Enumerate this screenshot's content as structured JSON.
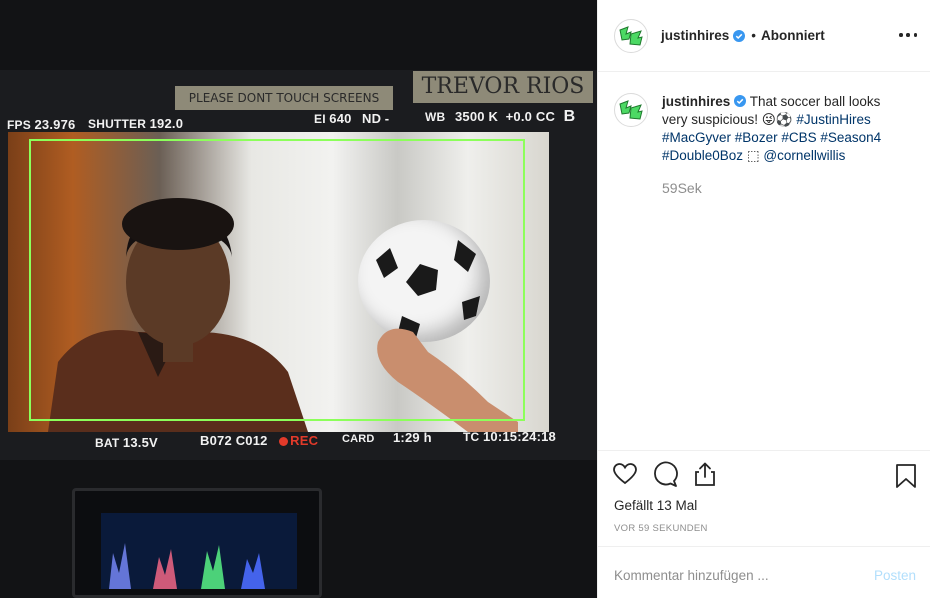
{
  "photo": {
    "monitor_top": {
      "fps_label": "FPS",
      "fps_value": "23.976",
      "shutter_label": "SHUTTER",
      "shutter_value": "192.0",
      "ei_label": "EI",
      "ei_value": "640",
      "nd_label": "ND",
      "nd_value": "-",
      "wb_label": "WB",
      "wb_value": "3500 K",
      "cc_value": "+0.0 CC",
      "b_label": "B"
    },
    "tape_left": "PLEASE DONT TOUCH SCREENS",
    "tape_right": "TREVOR RIOS",
    "monitor_bottom": {
      "bat_label": "BAT",
      "bat_value": "13.5V",
      "clip": "B072 C012",
      "rec": "REC",
      "card": "CARD",
      "remaining": "1:29 h",
      "tc_label": "TC",
      "tc_value": "10:15:24:18"
    }
  },
  "post": {
    "username": "justinhires",
    "follow_status": "Abonniert",
    "caption_prefix": "That soccer ball looks very suspicious! 😜⚽ ",
    "caption_tags": [
      "#JustinHires",
      "#MacGyver",
      "#Bozer",
      "#CBS",
      "#Season4",
      "#Double0Boz"
    ],
    "caption_box": "⬚",
    "caption_mention": "@cornellwillis",
    "caption_time": "59Sek",
    "likes": "Gefällt 13 Mal",
    "posted_ago": "VOR 59 SEKUNDEN",
    "comment_placeholder": "Kommentar hinzufügen ...",
    "post_button": "Posten"
  },
  "colors": {
    "verified": "#3897f0",
    "tag": "#003569",
    "muted": "#8e8e8e",
    "post_disabled": "#b2dffc",
    "avatar_green": "#4cd964",
    "frame_guide": "#8cff5a"
  },
  "icons": [
    "avatar-logo-icon",
    "verified-badge-icon",
    "more-options-icon",
    "heart-icon",
    "comment-icon",
    "share-icon",
    "bookmark-icon"
  ]
}
